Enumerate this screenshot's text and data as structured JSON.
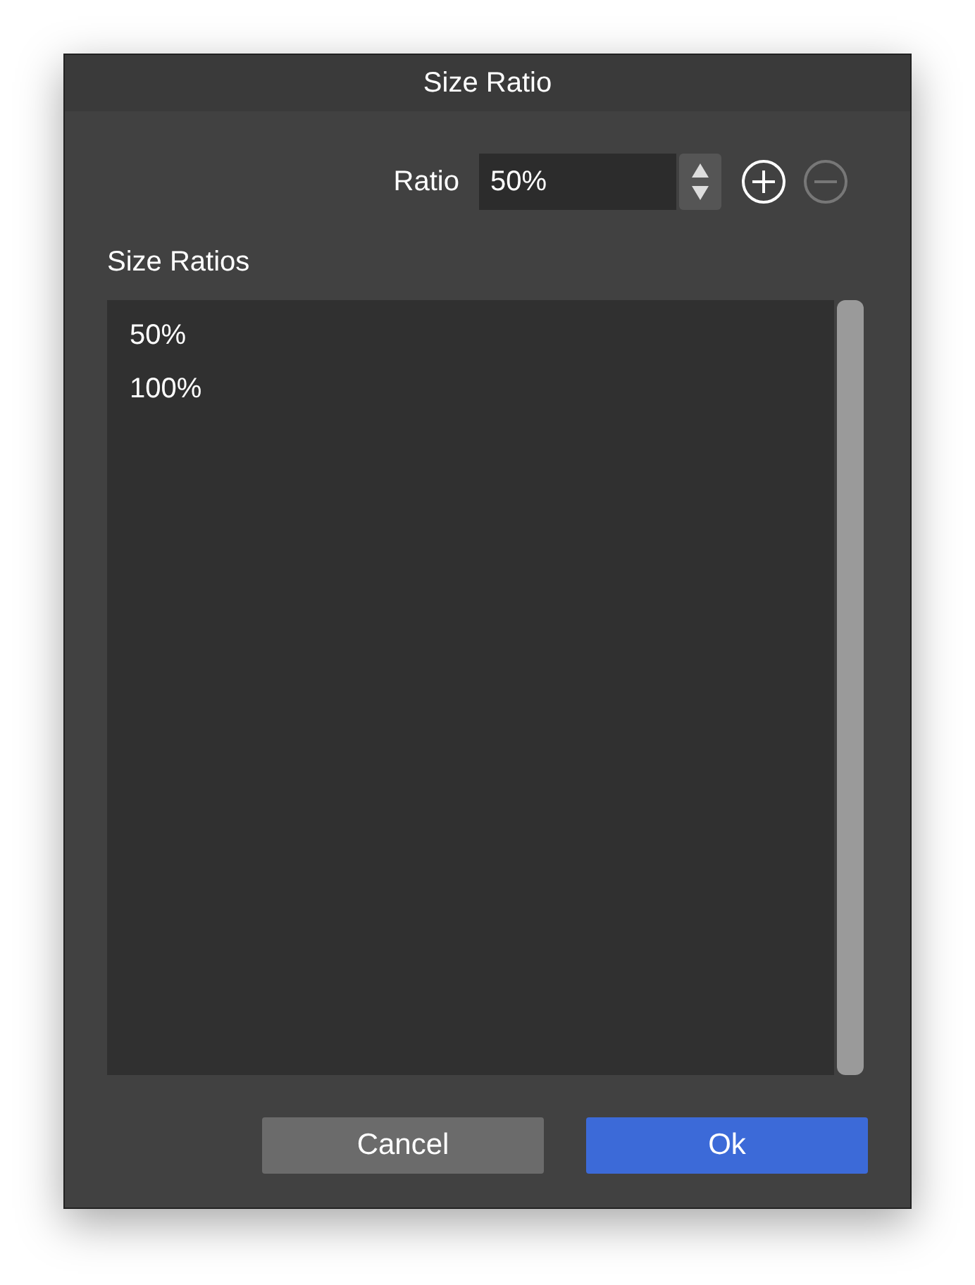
{
  "window": {
    "title": "Size Ratio"
  },
  "ratio": {
    "label": "Ratio",
    "value": "50%"
  },
  "add_button": {
    "disabled": false
  },
  "remove_button": {
    "disabled": true
  },
  "size_ratios": {
    "label": "Size Ratios",
    "items": [
      "50%",
      "100%"
    ]
  },
  "buttons": [
    {
      "label": "Cancel",
      "kind": "secondary"
    },
    {
      "label": "Ok",
      "kind": "primary"
    }
  ]
}
